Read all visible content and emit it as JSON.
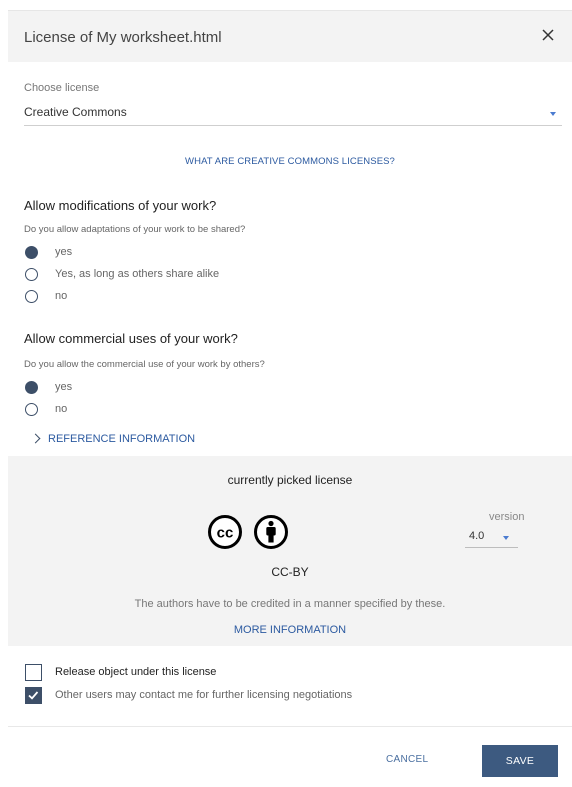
{
  "dialog": {
    "title": "License of My worksheet.html",
    "close_icon": "close-icon"
  },
  "license_select": {
    "label": "Choose license",
    "value": "Creative Commons"
  },
  "cc_link": "WHAT ARE CREATIVE COMMONS LICENSES?",
  "modifications": {
    "title": "Allow modifications of your work?",
    "question": "Do you allow adaptations of your work to be shared?",
    "options": [
      {
        "label": "yes",
        "checked": true
      },
      {
        "label": "Yes, as long as others share alike",
        "checked": false
      },
      {
        "label": "no",
        "checked": false
      }
    ]
  },
  "commercial": {
    "title": "Allow commercial uses of your work?",
    "question": "Do you allow the commercial use of your work by others?",
    "options": [
      {
        "label": "yes",
        "checked": true
      },
      {
        "label": "no",
        "checked": false
      }
    ]
  },
  "reference": {
    "label": "REFERENCE INFORMATION",
    "icon": "chevron-right-icon"
  },
  "picked": {
    "title": "currently picked license",
    "icons": [
      "cc-icon",
      "by-attribution-icon"
    ],
    "icon_text": "cc",
    "license_name": "CC-BY",
    "description": "The authors have to be credited in a manner specified by these.",
    "more_info": "MORE INFORMATION",
    "version_label": "version",
    "version_value": "4.0"
  },
  "checkboxes": [
    {
      "label": "Release object under this license",
      "checked": false
    },
    {
      "label": "Other users may contact me for further licensing negotiations",
      "checked": true
    }
  ],
  "actions": {
    "cancel": "CANCEL",
    "save": "SAVE"
  },
  "colors": {
    "header_bg": "#f3f3f3",
    "accent": "#3d5a80",
    "link": "#2c5aa0",
    "control": "#3d4f68"
  }
}
